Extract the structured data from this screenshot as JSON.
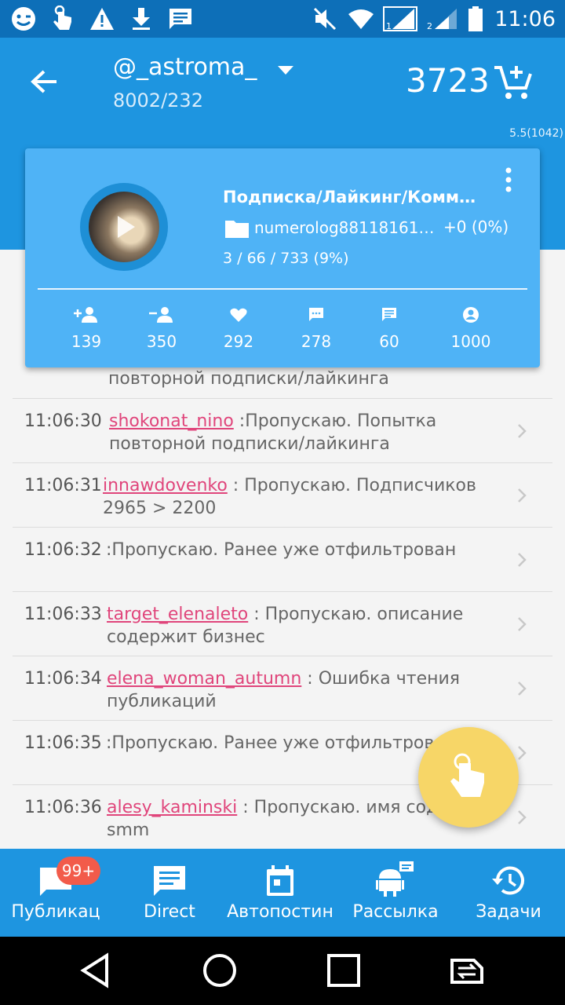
{
  "status_bar": {
    "time": "11:06",
    "left_icons": [
      "emoji-icon",
      "touch-icon",
      "warning-icon",
      "download-icon",
      "message-icon"
    ],
    "right_icons": [
      "mute-icon",
      "wifi-icon",
      "signal-sim1-icon",
      "signal-sim2-icon",
      "battery-icon"
    ],
    "sim1_label": "1",
    "sim2_label": "2"
  },
  "header": {
    "account_name": "@_astroma_",
    "account_stats": "8002/232",
    "balance": "3723"
  },
  "version": "5.5(1042)",
  "task_card": {
    "title": "Подписка/Лайкинг/Комме...",
    "source": "numerolog8811816109...",
    "delta": "+0 (0%)",
    "progress": "3 / 66 / 733 (9%)",
    "stats": [
      {
        "icon": "follow-icon",
        "value": "139"
      },
      {
        "icon": "unfollow-icon",
        "value": "350"
      },
      {
        "icon": "heart-icon",
        "value": "292"
      },
      {
        "icon": "comment-icon",
        "value": "278"
      },
      {
        "icon": "direct-message-icon",
        "value": "60"
      },
      {
        "icon": "profile-icon",
        "value": "1000"
      }
    ]
  },
  "log": {
    "partial_text": "повторной подписки/лайкинга",
    "rows": [
      {
        "time": "11:06:30",
        "user": "shokonat_nino",
        "text": " :Пропускаю. Попытка повторной подписки/лайкинга"
      },
      {
        "time": "11:06:31",
        "user": "innawdovenko",
        "text": " : Пропускаю. Подписчиков 2965 > 2200"
      },
      {
        "time": "11:06:32",
        "user": "",
        "text": ":Пропускаю. Ранее уже отфильтрован"
      },
      {
        "time": "11:06:33",
        "user": "target_elenaleto",
        "text": " : Пропускаю. описание содержит бизнес"
      },
      {
        "time": "11:06:34",
        "user": "elena_woman_autumn",
        "text": " : Ошибка чтения публикаций"
      },
      {
        "time": "11:06:35",
        "user": "",
        "text": ":Пропускаю. Ранее уже отфильтрован"
      },
      {
        "time": "11:06:36",
        "user": "alesy_kaminski",
        "text": " : Пропускаю. имя содержит smm"
      }
    ]
  },
  "bottom_nav": [
    {
      "label": "Публикац",
      "icon": "publications-icon",
      "badge": "99+"
    },
    {
      "label": "Direct",
      "icon": "direct-icon"
    },
    {
      "label": "Автопостин",
      "icon": "calendar-icon"
    },
    {
      "label": "Рассылка",
      "icon": "android-broadcast-icon"
    },
    {
      "label": "Задачи",
      "icon": "history-icon"
    }
  ],
  "colors": {
    "status_bar": "#0d6fb8",
    "primary": "#1e95e0",
    "card": "#4fb3f6",
    "username": "#e0457b",
    "fab": "#f7d667",
    "badge": "#f25b4a"
  }
}
